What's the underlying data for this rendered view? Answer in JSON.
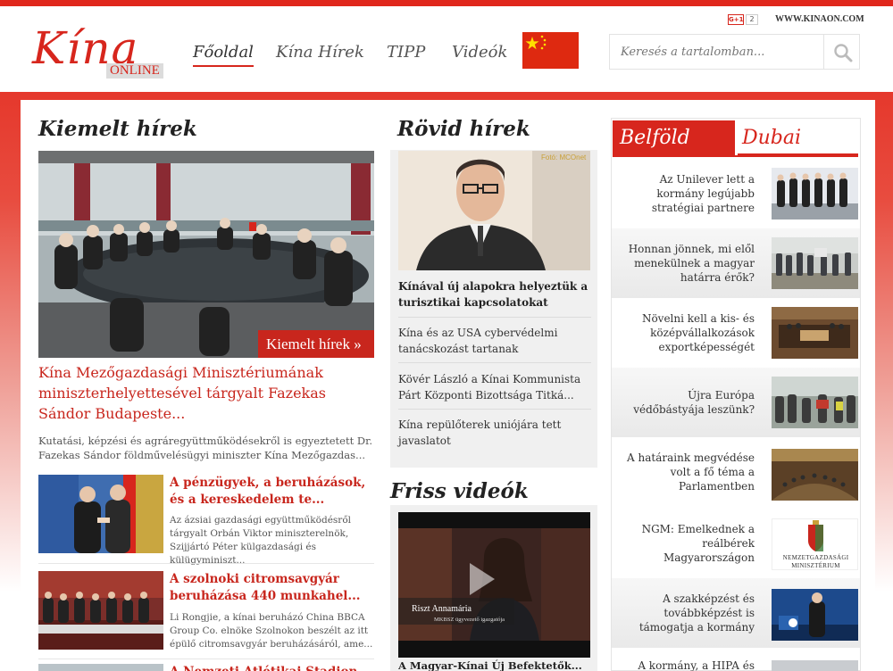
{
  "header": {
    "logo_main": "Kína",
    "logo_sub": "ONLINE",
    "nav": [
      {
        "label": "Főoldal"
      },
      {
        "label": "Kína Hírek"
      },
      {
        "label": "TIPP"
      },
      {
        "label": "Videók"
      }
    ],
    "gplus_label": "G+1",
    "gplus_count": "2",
    "site_url": "WWW.KINAON.COM",
    "search_placeholder": "Keresés a tartalomban..."
  },
  "featured": {
    "section_title": "Kiemelt hírek",
    "badge": "Kiemelt hírek »",
    "title": "Kína Mezőgazdasági Minisztériumának miniszterhelyettesével tárgyalt Fazekas Sándor Budapeste...",
    "excerpt": "Kutatási, képzési és agráregyüttműködésekről is egyeztetett Dr. Fazekas Sándor földművelésügyi miniszter Kína Mezőgazdas...",
    "items": [
      {
        "title": "A pénzügyek, a beruházások, és a kereskedelem te...",
        "text": "Az ázsiai gazdasági együttműködésről tárgyalt Orbán Viktor miniszterelnök, Szijjártó Péter külgazdasági és külügyminiszt..."
      },
      {
        "title": "A szolnoki citromsavgyár beruházása 440 munkahel...",
        "text": "Li Rongjie, a kínai beruházó China BBCA Group Co. elnöke Szolnokon beszélt az itt épülő citromsavgyár beruházásáról, ame..."
      },
      {
        "title": "A Nemzeti Atlétikai Stadion...",
        "text": ""
      }
    ]
  },
  "short_news": {
    "section_title": "Rövid hírek",
    "photo_credit": "Fotó: MCOnet",
    "lead": "Kínával új alapokra helyeztük a turisztikai kapcsolatokat",
    "items": [
      "Kína és az USA cybervédelmi tanácskozást tartanak",
      "Kövér László a Kínai Kommunista Párt Központi Bizottsága Titká...",
      "Kína repülőterek uniójára tett javaslatot"
    ]
  },
  "videos": {
    "section_title": "Friss videók",
    "lower_third_name": "Riszt Annamária",
    "lower_third_role": "MKBSZ ügyvezető igazgatója",
    "caption": "A Magyar-Kínai Új Befektetők..."
  },
  "sidebar": {
    "tabs": [
      {
        "label": "Belföld",
        "active": true
      },
      {
        "label": "Dubai",
        "active": false
      }
    ],
    "items": [
      {
        "text": "Az Unilever lett a kormány legújabb stratégiai partnere"
      },
      {
        "text": "Honnan jönnek, mi elől menekülnek a magyar határra érők?"
      },
      {
        "text": "Növelni kell a kis- és középvállalkozások exportképességét"
      },
      {
        "text": "Újra Európa védőbástyája leszünk?"
      },
      {
        "text": "A határaink megvédése volt a fő téma a Parlamentben"
      },
      {
        "text": "NGM: Emelkednek a reálbérek Magyarországon"
      },
      {
        "text": "A szakképzést és továbbképzést is támogatja a kormány"
      },
      {
        "text": "A kormány, a HIPA és az..."
      }
    ],
    "ngm_logo_line1": "Nemzetgazdasági",
    "ngm_logo_line2": "Minisztérium"
  },
  "colors": {
    "brand_red": "#d7261d",
    "link_red": "#c8261d",
    "flag_red": "#de2910",
    "flag_star": "#ffde00"
  }
}
